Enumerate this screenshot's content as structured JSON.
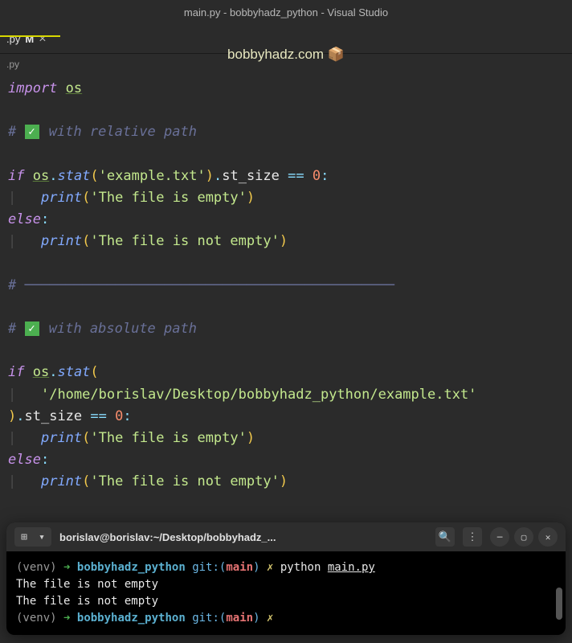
{
  "titleBar": "main.py - bobbyhadz_python - Visual Studio",
  "tab": {
    "name": ".py",
    "modified": "M",
    "close": "×"
  },
  "watermark": "bobbyhadz.com 📦",
  "breadcrumb": ".py",
  "code": {
    "import": "import",
    "os": "os",
    "comment1_prefix": "#",
    "comment1": " with relative path",
    "if": "if",
    "stat": "stat",
    "arg1": "'example.txt'",
    "st_size": "st_size",
    "eq": "==",
    "zero": "0",
    "colon": ":",
    "print": "print",
    "msg_empty": "'The file is empty'",
    "else": "else",
    "msg_not_empty": "'The file is not empty'",
    "divider": "# ─────────────────────────────────────────────",
    "comment2": " with absolute path",
    "abspath": "'/home/borislav/Desktop/bobbyhadz_python/example.txt'",
    "pipe": "|"
  },
  "terminal": {
    "title": "borislav@borislav:~/Desktop/bobbyhadz_...",
    "venv": "(venv)",
    "arrow": "➜",
    "dir": "bobbyhadz_python",
    "git_label": "git:(",
    "branch": "main",
    "git_close": ")",
    "x": "✗",
    "cmd": "python",
    "file": "main.py",
    "output1": "The file is not empty",
    "output2": "The file is not empty"
  }
}
